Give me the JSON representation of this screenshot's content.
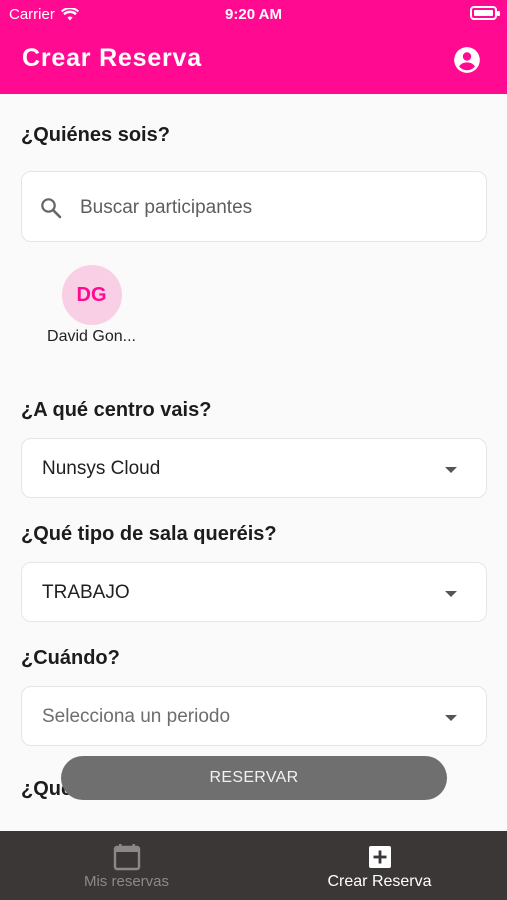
{
  "status_bar": {
    "carrier": "Carrier",
    "time": "9:20 AM"
  },
  "header": {
    "title": "Crear Reserva",
    "profile_icon": "account-circle-icon"
  },
  "colors": {
    "brand": "#ff0a91",
    "nav_bg": "#3b3737",
    "button_disabled": "#6f6f6f"
  },
  "form": {
    "participants": {
      "label": "¿Quiénes sois?",
      "search_placeholder": "Buscar participantes",
      "selected": [
        {
          "initials": "DG",
          "name": "David Gon..."
        }
      ]
    },
    "center": {
      "label": "¿A qué centro vais?",
      "value": "Nunsys Cloud"
    },
    "room_type": {
      "label": "¿Qué tipo de sala queréis?",
      "value": "TRABAJO"
    },
    "when": {
      "label": "¿Cuándo?",
      "placeholder": "Selecciona un periodo"
    },
    "next_label_partial": "¿Qué"
  },
  "reserve_button": "RESERVAR",
  "bottom_nav": [
    {
      "label": "Mis reservas",
      "icon": "calendar-icon",
      "active": false
    },
    {
      "label": "Crear Reserva",
      "icon": "add-box-icon",
      "active": true
    }
  ]
}
